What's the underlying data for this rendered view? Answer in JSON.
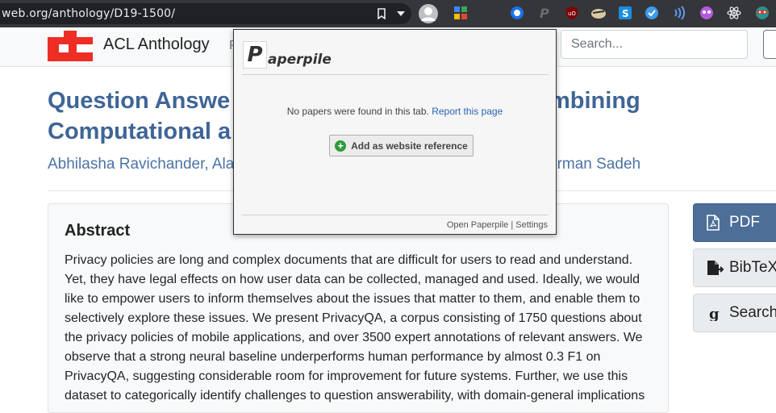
{
  "browser": {
    "url": "web.org/anthology/D19-1500/"
  },
  "site": {
    "name": "ACL Anthology",
    "nav_partial": "P",
    "search_placeholder": "Search...",
    "logo_color": "#ee2e24"
  },
  "paper": {
    "title": "Question Answe                    mbining",
    "title_line1_left": "Question Answe",
    "title_line1_right": "mbining",
    "title_line2_left": "Computational a",
    "authors_left": "Abhilasha Ravichander, Ala",
    "authors_right": "orman Sadeh",
    "abstract_heading": "Abstract",
    "abstract_text": "Privacy policies are long and complex documents that are difficult for users to read and understand. Yet, they have legal effects on how user data can be collected, managed and used. Ideally, we would like to empower users to inform themselves about the issues that matter to them, and enable them to selectively explore these issues. We present PrivacyQA, a corpus consisting of 1750 questions about the privacy policies of mobile applications, and over 3500 expert annotations of relevant answers. We observe that a strong neural baseline underperforms human performance by almost 0.3 F1 on PrivacyQA, suggesting considerable room for improvement for future systems. Further, we use this dataset to categorically identify challenges to question answerability, with domain-general implications"
  },
  "side_buttons": {
    "pdf": "PDF",
    "bibtex": "BibTeX",
    "search": "Search"
  },
  "popup": {
    "logo_letter": "P",
    "logo_word": "aperpile",
    "message": "No papers were found in this tab.",
    "report_link": "Report this page",
    "add_button": "Add as website reference",
    "footer_open": "Open Paperpile",
    "footer_sep": "|",
    "footer_settings": "Settings"
  },
  "colors": {
    "title": "#3f6596",
    "pdf_button": "#4d6e97",
    "toolbar": "#35363a"
  }
}
